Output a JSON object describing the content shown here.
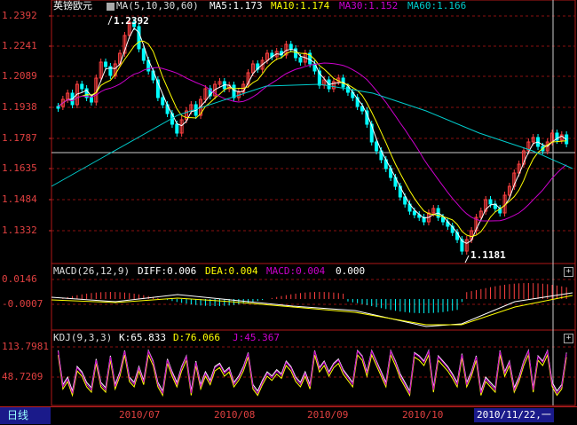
{
  "main_panel": {
    "symbol": "英镑欧元",
    "ma_label": "MA(5,10,30,60)",
    "ma5": "MA5:1.173",
    "ma10": "MA10:1.174",
    "ma30": "MA30:1.152",
    "ma60": "MA60:1.166",
    "high_marker": "1.2392",
    "low_marker": "1.1181",
    "y_ticks": [
      "1.2392",
      "1.2241",
      "1.2089",
      "1.1938",
      "1.1787",
      "1.1635",
      "1.1484",
      "1.1332"
    ]
  },
  "macd_panel": {
    "label": "MACD(26,12,9)",
    "diff": "DIFF:0.006",
    "dea": "DEA:0.004",
    "macd": "MACD:0.004",
    "extra": "0.000",
    "y_ticks": [
      "0.0146",
      "-0.0007"
    ]
  },
  "kdj_panel": {
    "label": "KDJ(9,3,3)",
    "k": "K:65.833",
    "d": "D:76.066",
    "j": "J:45.367",
    "y_ticks": [
      "113.7981",
      "48.7209"
    ]
  },
  "status_bar": {
    "period_tab": "日线",
    "dates": [
      "2010/07",
      "2010/08",
      "2010/09",
      "2010/10"
    ],
    "cursor_date": "2010/11/22,一"
  },
  "panel_buttons": {
    "plus": "+"
  },
  "colors": {
    "ma5": "#ffffff",
    "ma10": "#ffff00",
    "ma30": "#cc00cc",
    "ma60": "#00cccc",
    "up": "#ff4040",
    "down": "#00ffff",
    "grid": "#8a1010",
    "axis_text": "#e04040"
  }
}
